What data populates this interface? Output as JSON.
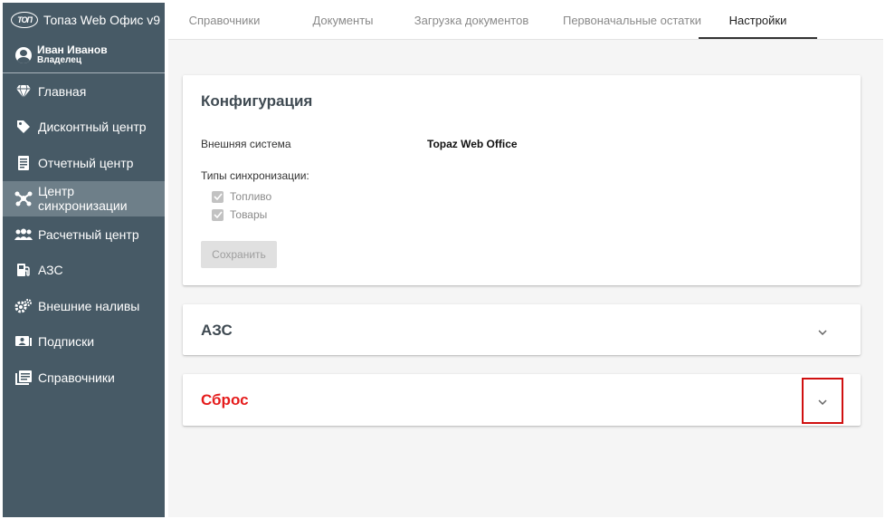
{
  "app": {
    "logo_text": "ТОП",
    "title": "Топаз Web Офис v9"
  },
  "user": {
    "name": "Иван Иванов",
    "role": "Владелец"
  },
  "sidebar": {
    "items": [
      {
        "label": "Главная",
        "icon": "diamond-icon"
      },
      {
        "label": "Дисконтный центр",
        "icon": "tag-icon"
      },
      {
        "label": "Отчетный центр",
        "icon": "report-icon"
      },
      {
        "label": "Центр синхронизации",
        "icon": "network-icon",
        "active": true
      },
      {
        "label": "Расчетный центр",
        "icon": "users-icon"
      },
      {
        "label": "АЗС",
        "icon": "gas-station-icon"
      },
      {
        "label": "Внешние наливы",
        "icon": "cogs-icon"
      },
      {
        "label": "Подписки",
        "icon": "subscription-icon"
      },
      {
        "label": "Справочники",
        "icon": "book-icon"
      }
    ]
  },
  "tabs": [
    {
      "label": "Справочники"
    },
    {
      "label": "Документы"
    },
    {
      "label": "Загрузка документов"
    },
    {
      "label": "Первоначальные остатки"
    },
    {
      "label": "Настройки",
      "active": true
    }
  ],
  "config": {
    "title": "Конфигурация",
    "external_system_label": "Внешняя система",
    "external_system_value": "Topaz Web Office",
    "sync_types_label": "Типы синхронизации:",
    "sync_types": [
      {
        "label": "Топливо",
        "checked": true
      },
      {
        "label": "Товары",
        "checked": true
      }
    ],
    "save_label": "Сохранить"
  },
  "azs_panel": {
    "title": "АЗС"
  },
  "reset_panel": {
    "title": "Сброс"
  },
  "colors": {
    "sidebar_bg": "#475a66",
    "sidebar_active": "#6e7f89",
    "danger": "#e51c1c",
    "highlight_box": "#d01010"
  }
}
